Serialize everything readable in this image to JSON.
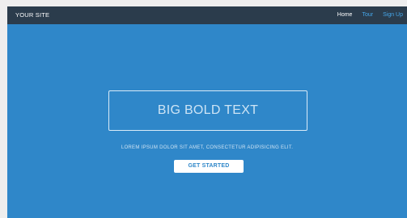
{
  "navbar": {
    "brand": "YOUR SITE",
    "links": [
      {
        "label": "Home",
        "active": true
      },
      {
        "label": "Tour",
        "active": false
      },
      {
        "label": "Sign Up",
        "active": false
      }
    ]
  },
  "hero": {
    "title": "BIG BOLD TEXT",
    "tagline": "LOREM IPSUM DOLOR SIT AMET, CONSECTETUR ADIPISICING ELIT.",
    "cta_label": "GET STARTED"
  },
  "colors": {
    "page_background": "#eeeeee",
    "hero_background": "#2f87c9",
    "navbar_background": "#2b3c4c",
    "nav_active": "#ffffff",
    "nav_inactive": "#46a7ea",
    "cta_background": "#ffffff",
    "cta_text": "#2f87c9"
  }
}
